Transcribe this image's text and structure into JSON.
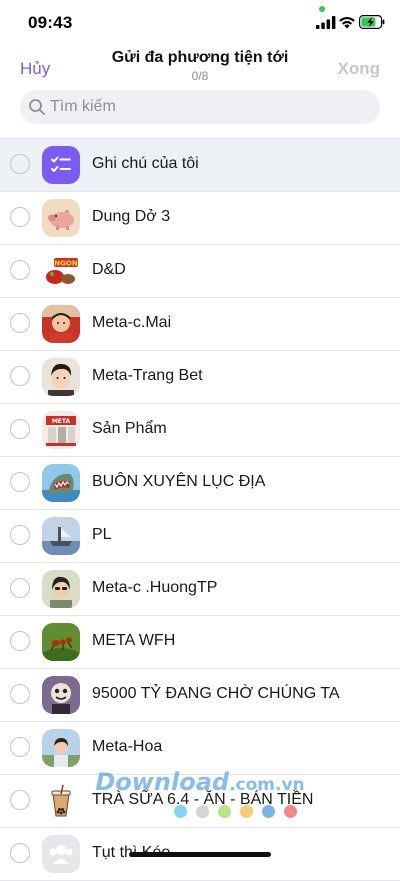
{
  "status_bar": {
    "time": "09:43",
    "accent_dot_color": "#34c759",
    "icons": [
      "signal-icon",
      "wifi-icon",
      "battery-charging-icon"
    ]
  },
  "header": {
    "cancel_label": "Hủy",
    "title": "Gửi đa phương tiện tới",
    "count": "0/8",
    "done_label": "Xong",
    "accent_color": "#7a5cf5"
  },
  "search": {
    "placeholder": "Tìm kiếm",
    "value": ""
  },
  "contacts": [
    {
      "name": "Ghi chú của tôi",
      "avatar": "notes-icon",
      "highlighted": true
    },
    {
      "name": "Dung Dở 3",
      "avatar": "pig-avatar"
    },
    {
      "name": "D&D",
      "avatar": "ngon-food-avatar"
    },
    {
      "name": "Meta-c.Mai",
      "avatar": "child-avatar"
    },
    {
      "name": "Meta-Trang Bet",
      "avatar": "portrait-avatar"
    },
    {
      "name": "Sản Phẩm",
      "avatar": "store-avatar"
    },
    {
      "name": "BUÔN XUYÊN LỤC ĐỊA",
      "avatar": "shark-avatar"
    },
    {
      "name": "PL",
      "avatar": "ship-avatar"
    },
    {
      "name": "Meta-c .HuongTP",
      "avatar": "woman-avatar"
    },
    {
      "name": "META WFH",
      "avatar": "ant-avatar"
    },
    {
      "name": "95000 TỶ ĐANG CHỜ CHÚNG TA",
      "avatar": "cartoon-avatar"
    },
    {
      "name": "Meta-Hoa",
      "avatar": "outdoor-avatar"
    },
    {
      "name": "TRÀ SỮA 6.4 - ĂN - BÁN TIỀN",
      "avatar": "bubble-tea-avatar"
    },
    {
      "name": "Tụt thì Kéo",
      "avatar": "group-avatar"
    }
  ],
  "watermark": {
    "text": "Download",
    "suffix": ".com.vn"
  }
}
